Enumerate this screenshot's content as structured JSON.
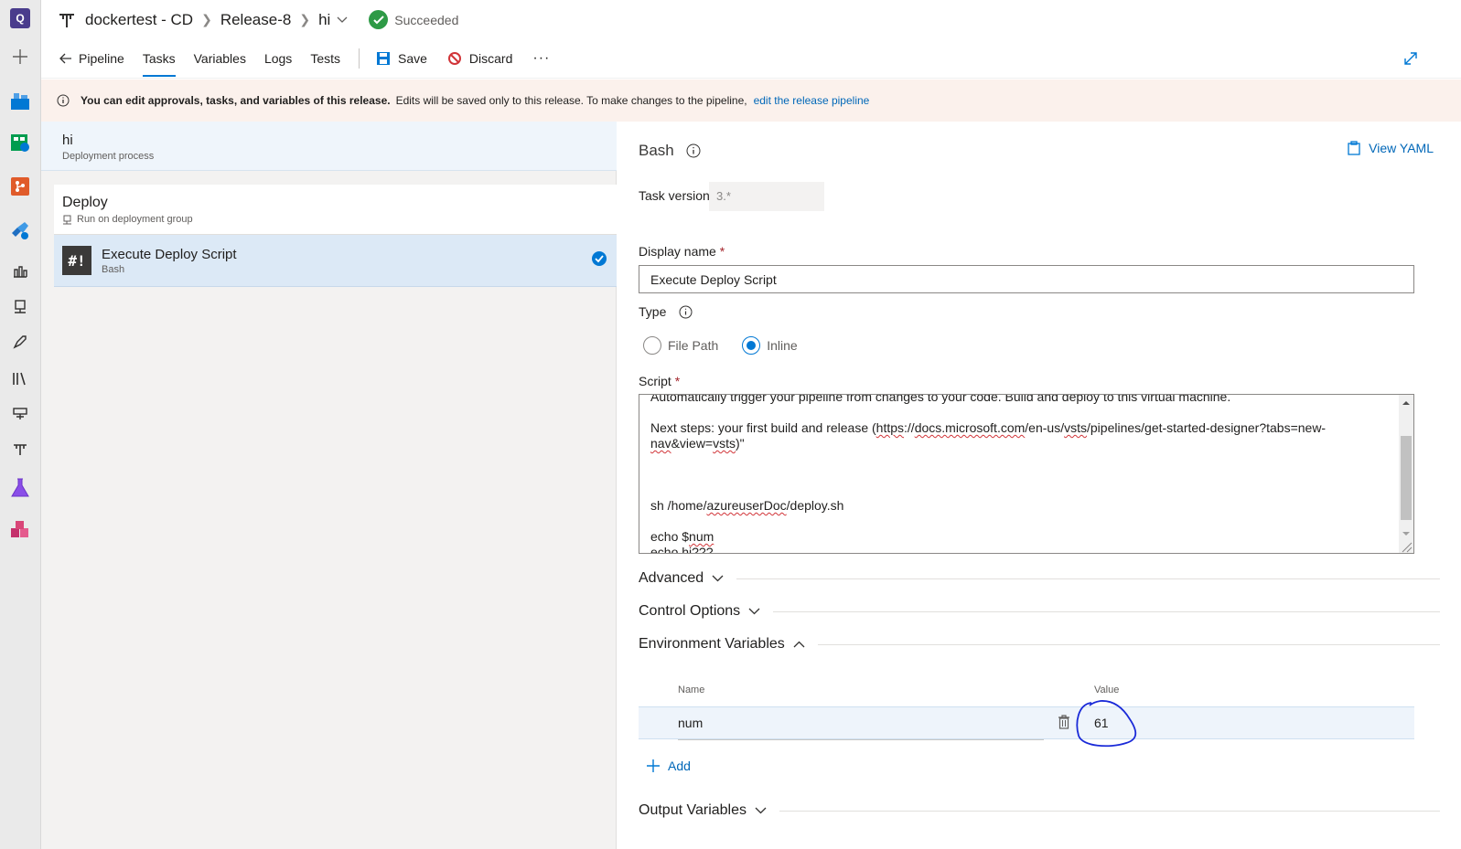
{
  "org": {
    "letter": "Q"
  },
  "breadcrumb": {
    "pipeline": "dockertest - CD",
    "release": "Release-8",
    "stage": "hi",
    "status": "Succeeded"
  },
  "toolbar": {
    "back": "Pipeline",
    "tabs": [
      "Tasks",
      "Variables",
      "Logs",
      "Tests"
    ],
    "save": "Save",
    "discard": "Discard",
    "more": "···"
  },
  "banner": {
    "bold": "You can edit approvals, tasks, and variables of this release.",
    "text": "Edits will be saved only to this release. To make changes to the pipeline,",
    "link": "edit the release pipeline"
  },
  "process": {
    "title": "hi",
    "subtitle": "Deployment process"
  },
  "stage": {
    "title": "Deploy",
    "subtitle": "Run on deployment group"
  },
  "task": {
    "icon_text": "#!",
    "title": "Execute Deploy Script",
    "subtitle": "Bash"
  },
  "details": {
    "title": "Bash",
    "view_yaml": "View YAML",
    "task_version_label": "Task version",
    "task_version": "3.*",
    "display_name_label": "Display name",
    "display_name": "Execute Deploy Script",
    "type_label": "Type",
    "type_options": [
      "File Path",
      "Inline"
    ],
    "script_label": "Script",
    "script": {
      "line0": "Automatically trigger your pipeline from changes to your code. Build and deploy to this virtual machine.",
      "line1a": "Next steps: your first build and release (",
      "line1b": "https",
      "line1c": "://",
      "line1d": "docs.microsoft.com",
      "line1e": "/en-us/",
      "line1f": "vsts",
      "line1g": "/pipelines/get-started-designer?tabs=new-",
      "line2a": "nav",
      "line2b": "&view=",
      "line2c": "vsts",
      "line2d": ")\"",
      "line3a": "sh /home/",
      "line3b": "azureuserDoc",
      "line3c": "/deploy.sh",
      "line4a": "echo $",
      "line4b": "num",
      "line5": "echo hi???"
    },
    "sections": {
      "advanced": "Advanced",
      "control": "Control Options",
      "env": "Environment Variables",
      "output": "Output Variables"
    },
    "env": {
      "name_header": "Name",
      "value_header": "Value",
      "name": "num",
      "value": "61",
      "add": "Add"
    }
  },
  "colors": {
    "accent": "#0078d4",
    "success": "#2e9a46",
    "banner": "#fbf1ec",
    "annotation": "#1a2ad8"
  }
}
